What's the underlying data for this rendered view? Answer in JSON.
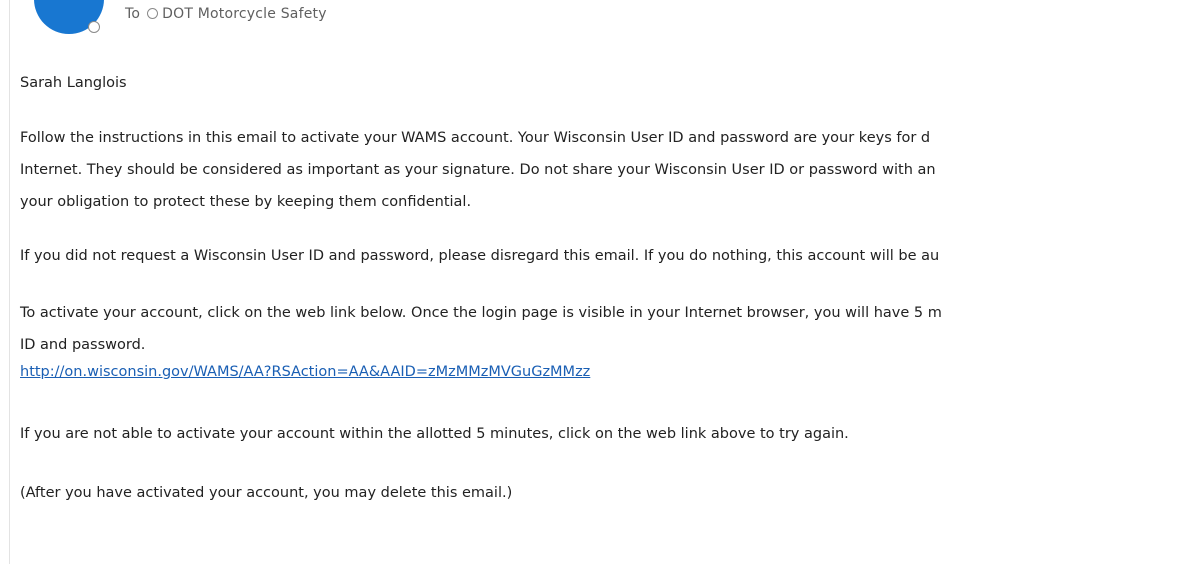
{
  "header": {
    "to_label": "To",
    "recipient": "DOT Motorcycle Safety"
  },
  "message": {
    "greeting": "Sarah Langlois",
    "para1": [
      "Follow the instructions in this email to activate your WAMS account. Your Wisconsin User ID and password are your keys for d",
      "Internet. They should be considered as important as your signature. Do not share your Wisconsin User ID or password with an",
      "your obligation to protect these by keeping them confidential."
    ],
    "para2": "If you did not request a Wisconsin User ID and password, please disregard this email. If you do nothing, this account will be au",
    "para3": [
      "To activate your account, click on the web link below. Once the login page is visible in your Internet browser, you will have 5 m",
      "ID and password."
    ],
    "activation_link": "http://on.wisconsin.gov/WAMS/AA?RSAction=AA&AAID=zMzMMzMVGuGzMMzz",
    "para4": "If you are not able to activate your account within the allotted 5 minutes, click on the web link above to try again.",
    "para5": "(After you have activated your account, you may delete this email.)"
  }
}
